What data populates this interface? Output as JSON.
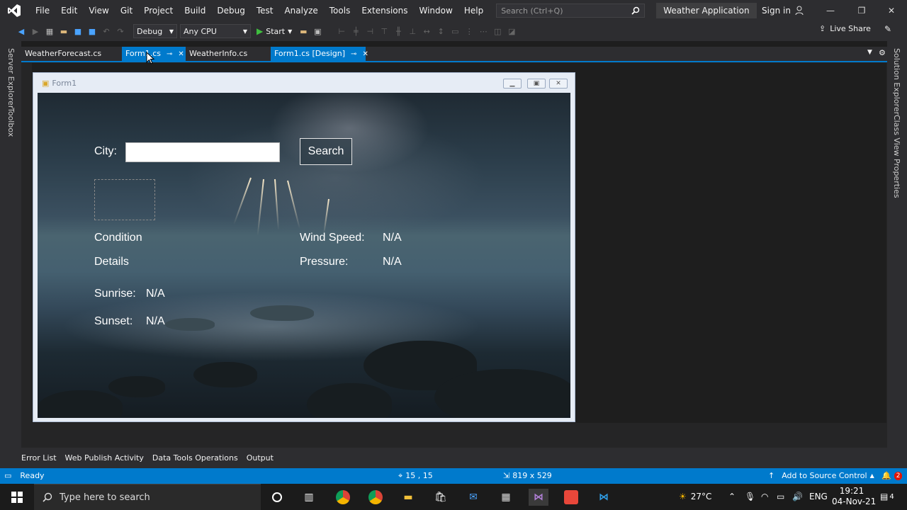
{
  "menu": {
    "items": [
      "File",
      "Edit",
      "View",
      "Git",
      "Project",
      "Build",
      "Debug",
      "Test",
      "Analyze",
      "Tools",
      "Extensions",
      "Window",
      "Help"
    ],
    "search_placeholder": "Search (Ctrl+Q)",
    "solution_name": "Weather Application",
    "sign_in": "Sign in"
  },
  "toolbar": {
    "config": "Debug",
    "platform": "Any CPU",
    "start_label": "Start",
    "live_share": "Live Share"
  },
  "side_panels": {
    "left": [
      "Server Explorer",
      "Toolbox"
    ],
    "right": [
      "Solution Explorer",
      "Class View",
      "Properties"
    ]
  },
  "tabs": [
    {
      "label": "WeatherForecast.cs"
    },
    {
      "label": "Form1.cs"
    },
    {
      "label": "WeatherInfo.cs"
    },
    {
      "label": "Form1.cs [Design]"
    }
  ],
  "form": {
    "title": "Form1",
    "city_label": "City:",
    "city_value": "",
    "search_button": "Search",
    "condition_label": "Condition",
    "details_label": "Details",
    "sunrise_label": "Sunrise:",
    "sunrise_value": "N/A",
    "sunset_label": "Sunset:",
    "sunset_value": "N/A",
    "wind_label": "Wind Speed:",
    "wind_value": "N/A",
    "pressure_label": "Pressure:",
    "pressure_value": "N/A"
  },
  "bottom_tabs": [
    "Error List",
    "Web Publish Activity",
    "Data Tools Operations",
    "Output"
  ],
  "status": {
    "ready": "Ready",
    "position": "15 , 15",
    "size": "819 x 529",
    "source_control": "Add to Source Control",
    "notifications": "2"
  },
  "taskbar": {
    "search_placeholder": "Type here to search",
    "weather": "27°C",
    "language": "ENG",
    "time": "19:21",
    "date": "04-Nov-21",
    "notification_count": "4"
  },
  "colors": {
    "accent": "#007acc",
    "chrome": "#2d2d30",
    "background": "#1e1e1e"
  }
}
